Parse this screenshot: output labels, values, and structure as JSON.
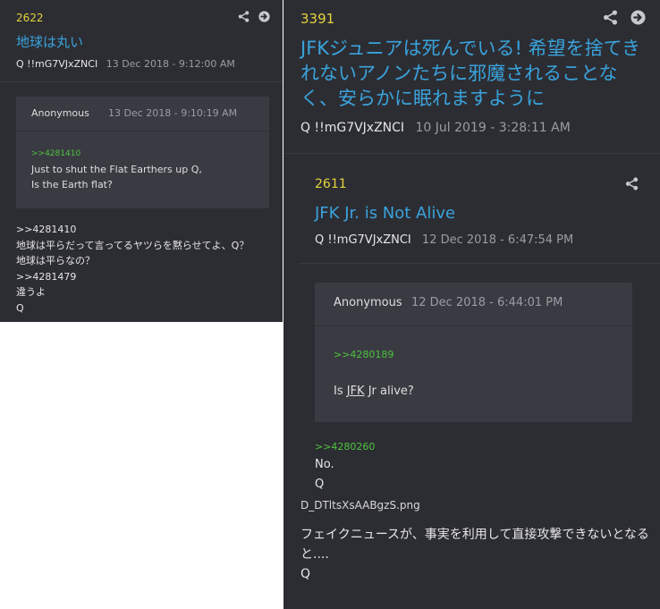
{
  "left_post": {
    "number": "2622",
    "title": "地球は丸い",
    "author": "Q",
    "tripcode": "!!mG7VJxZNCI",
    "date": "13 Dec 2018 - 9:12:00 AM",
    "icons": [
      "share-icon",
      "arrow-right-circle-icon"
    ],
    "quote": {
      "author": "Anonymous",
      "date": "13 Dec 2018 - 9:10:19 AM",
      "reply_link": ">>4281410",
      "lines": [
        "Just to shut the Flat Earthers up Q,",
        "Is the Earth flat?"
      ]
    },
    "body_lines": [
      ">>4281410",
      "地球は平らだって言ってるヤツらを黙らせてよ、Q？",
      "地球は平らなの？",
      ">>4281479",
      "違うよ",
      "Q"
    ]
  },
  "right_post": {
    "number": "3391",
    "title": "JFKジュニアは死んでいる! 希望を捨てきれないアノンたちに邪魔されることなく、安らかに眠れますように",
    "author": "Q",
    "tripcode": "!!mG7VJxZNCI",
    "date": "10 Jul 2019 - 3:28:11 AM",
    "icons": [
      "share-icon",
      "arrow-right-circle-icon"
    ],
    "inner_post": {
      "number": "2611",
      "title": "JFK Jr. is Not Alive",
      "author": "Q",
      "tripcode": "!!mG7VJxZNCI",
      "date": "12 Dec 2018 - 6:47:54 PM",
      "icons": [
        "share-icon"
      ],
      "quote": {
        "author": "Anonymous",
        "date": "12 Dec 2018 - 6:44:01 PM",
        "reply_link": ">>4280189",
        "text_before": "Is ",
        "text_underlined": "JFK",
        "text_after": " Jr alive?"
      },
      "reply_link": ">>4280260",
      "answer_lines": [
        "No.",
        "Q"
      ]
    },
    "file_name": "D_DTltsXsAABgzS.png",
    "body_lines": [
      "フェイクニュースが、事実を利用して直接攻撃できないとなると....",
      "Q"
    ]
  }
}
